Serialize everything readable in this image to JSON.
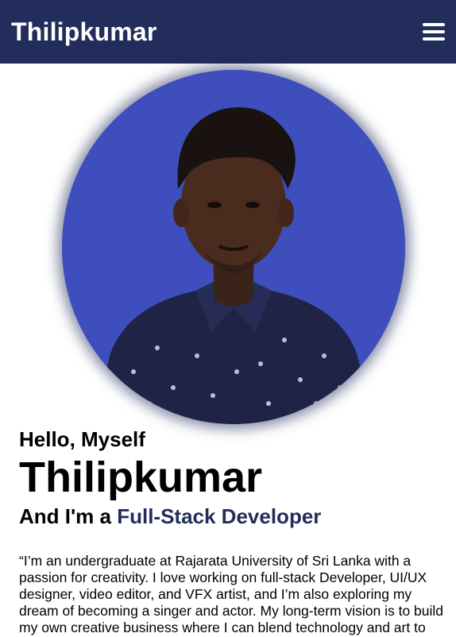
{
  "navbar": {
    "brand": "Thilipkumar",
    "menu_icon": "hamburger-icon",
    "background": "#222d5b"
  },
  "hero": {
    "portrait_bg": "#3e4fbd",
    "greeting": "Hello, Myself",
    "name": "Thilipkumar",
    "role_prefix": "And I'm a ",
    "role": "Full-Stack Developer",
    "accent_color": "#222d5b",
    "bio": "“I’m an undergraduate at Rajarata University of Sri Lanka with a passion for creativity. I love working on full-stack Developer, UI/UX designer, video editor, and VFX artist, and I’m also exploring my dream of becoming a singer and actor. My long-term vision is to build my own creative business where I can blend technology and art to"
  }
}
